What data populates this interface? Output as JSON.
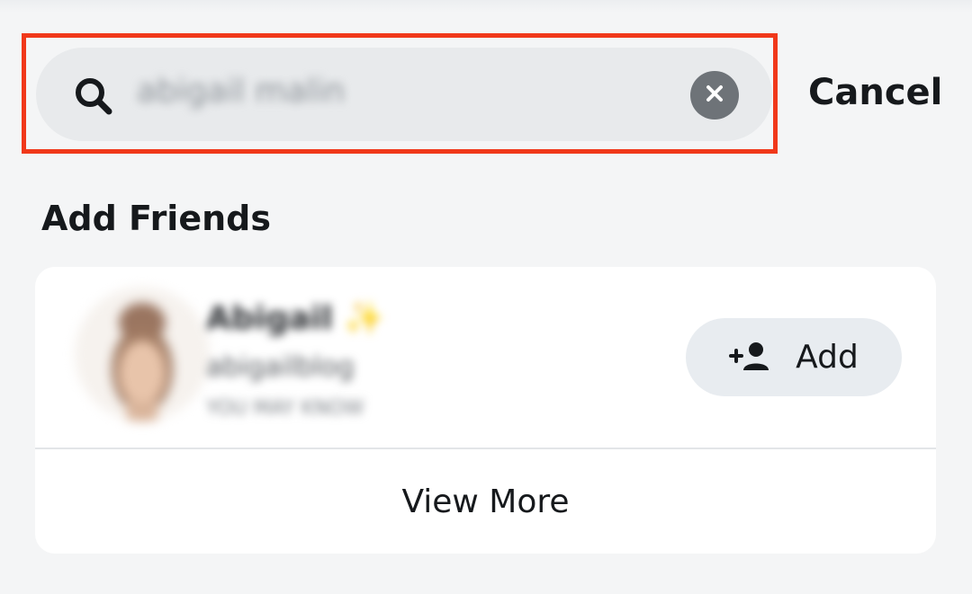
{
  "search": {
    "query": "abigail malin",
    "icon": "search-icon",
    "clear_icon": "close-icon",
    "cancel_label": "Cancel",
    "highlight_color": "#f0381a"
  },
  "section": {
    "title": "Add Friends"
  },
  "results": [
    {
      "name": "Abigail ✨",
      "username": "abigailblog",
      "meta": "YOU MAY KNOW",
      "add_label": "Add",
      "add_icon": "add-friend-icon"
    }
  ],
  "footer": {
    "view_more_label": "View More"
  }
}
